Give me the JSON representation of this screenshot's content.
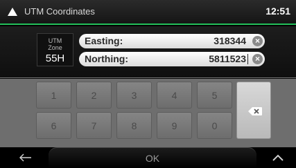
{
  "header": {
    "title": "UTM Coordinates",
    "clock": "12:51",
    "back_icon": "triangle-up-icon",
    "accent_color": "#24c15a"
  },
  "zone": {
    "label": "UTM\nZone",
    "value": "55H"
  },
  "fields": {
    "easting": {
      "label": "Easting:",
      "value": "318344",
      "clear_icon": "clear-icon"
    },
    "northing": {
      "label": "Northing:",
      "value": "5811523",
      "clear_icon": "clear-icon"
    }
  },
  "keyboard": {
    "row1": [
      "1",
      "2",
      "3",
      "4",
      "5"
    ],
    "row2": [
      "6",
      "7",
      "8",
      "9",
      "0"
    ],
    "backspace_icon": "backspace-icon"
  },
  "bottom": {
    "back_icon": "arrow-left-icon",
    "ok_label": "OK",
    "expand_icon": "chevron-up-icon"
  }
}
